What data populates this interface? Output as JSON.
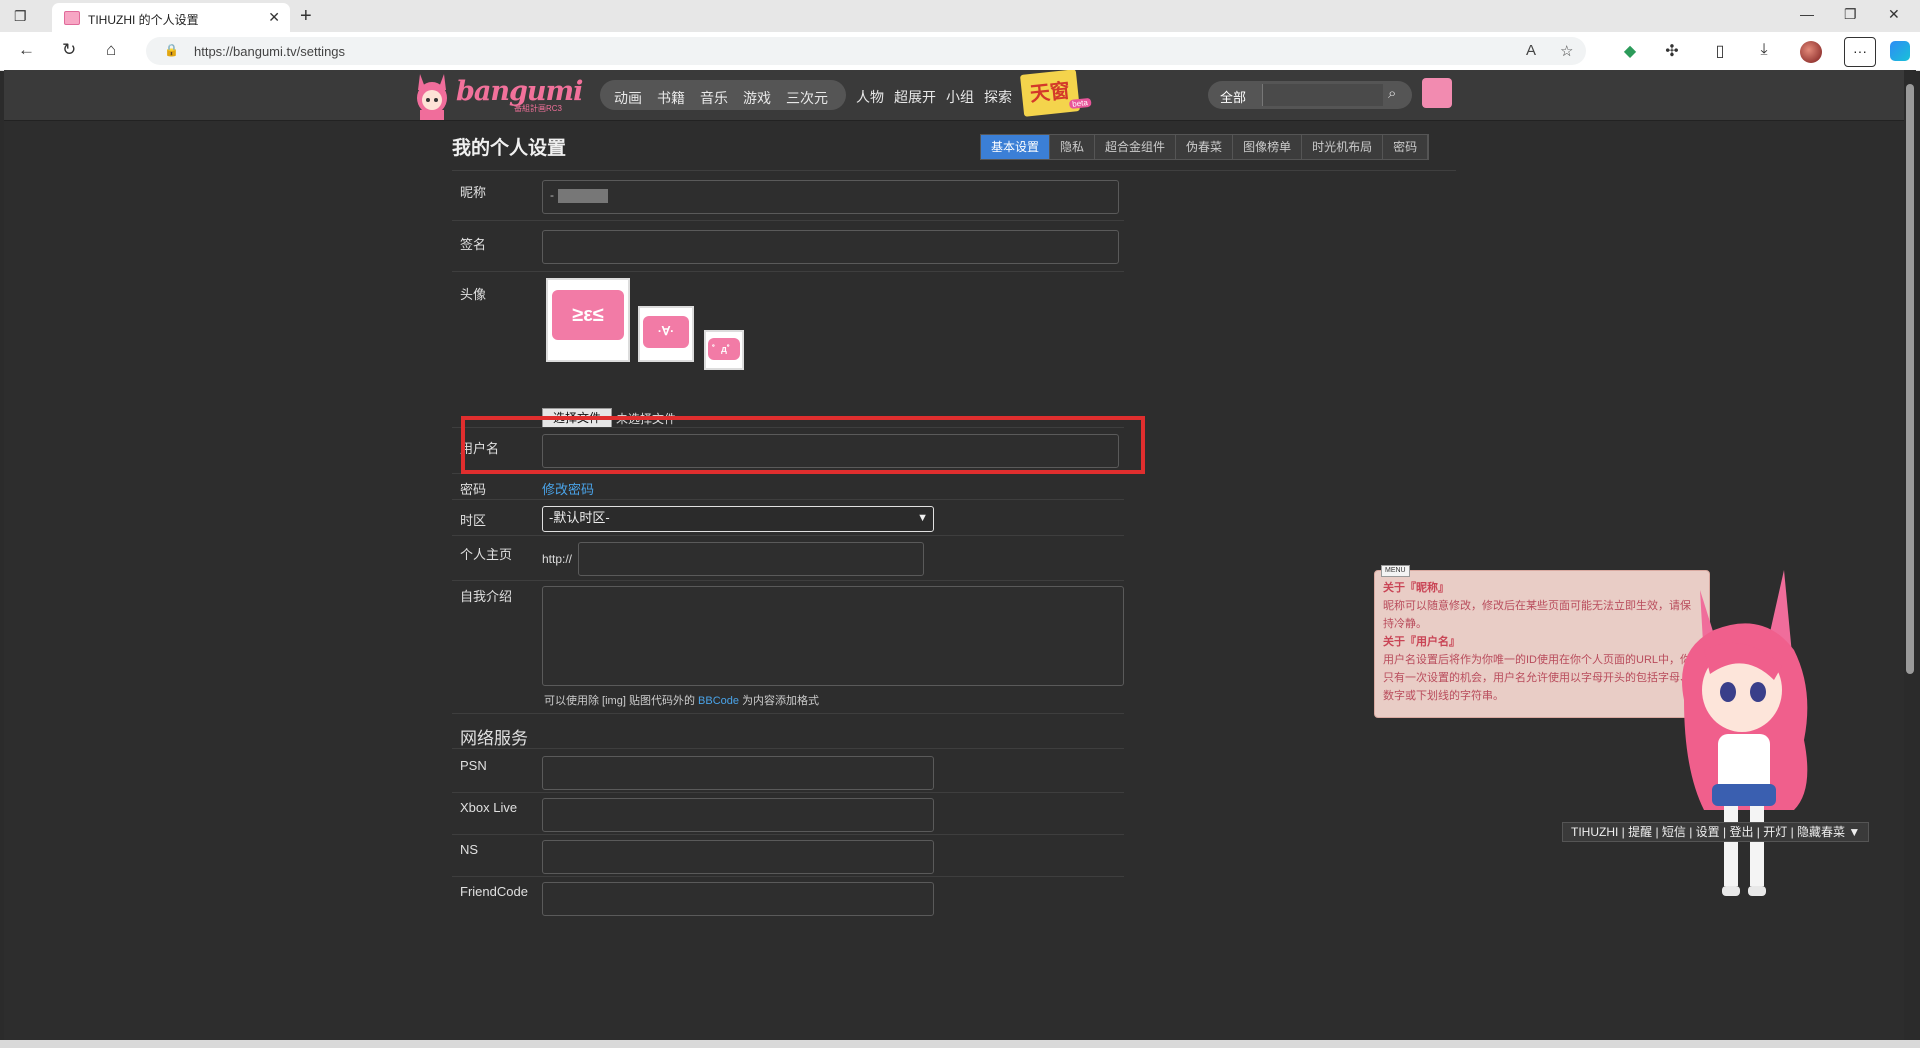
{
  "browser": {
    "tab_title": "TIHUZHI 的个人设置",
    "url": "https://bangumi.tv/settings"
  },
  "header": {
    "logo": "bangumi",
    "logo_sub": "番組計画RC3",
    "categories": [
      "动画",
      "书籍",
      "音乐",
      "游戏",
      "三次元"
    ],
    "links": [
      "人物",
      "超展开",
      "小组",
      "探索"
    ],
    "tianku": "天窗",
    "search_category": "全部",
    "search_icon": "search-icon"
  },
  "page": {
    "title": "我的个人设置",
    "tabs": [
      "基本设置",
      "隐私",
      "超合金组件",
      "伪春菜",
      "图像榜单",
      "时光机布局",
      "密码"
    ],
    "active_tab": "基本设置"
  },
  "form": {
    "nickname_label": "昵称",
    "nickname_value": "-",
    "sign_label": "签名",
    "avatar_label": "头像",
    "file_button": "选择文件",
    "file_status": "未选择文件",
    "username_label": "用户名",
    "password_label": "密码",
    "password_link": "修改密码",
    "timezone_label": "时区",
    "timezone_value": "-默认时区-",
    "homepage_label": "个人主页",
    "homepage_prefix": "http://",
    "intro_label": "自我介绍",
    "hint_prefix": "可以使用除 [img] 贴图代码外的",
    "hint_link": "BBCode",
    "hint_suffix": "为内容添加格式"
  },
  "network": {
    "title": "网络服务",
    "services": [
      "PSN",
      "Xbox Live",
      "NS",
      "FriendCode"
    ]
  },
  "mascot": {
    "menu": "MENU",
    "h1": "关于『昵称』",
    "t1": "昵称可以随意修改，修改后在某些页面可能无法立即生效，请保持冷静。",
    "h2": "关于『用户名』",
    "t2": "用户名设置后将作为你唯一的ID使用在你个人页面的URL中，你只有一次设置的机会，用户名允许使用以字母开头的包括字母、数字或下划线的字符串。"
  },
  "bottombar": "TIHUZHI | 提醒 | 短信 | 设置 | 登出 | 开灯 | 隐藏春菜 ▼"
}
